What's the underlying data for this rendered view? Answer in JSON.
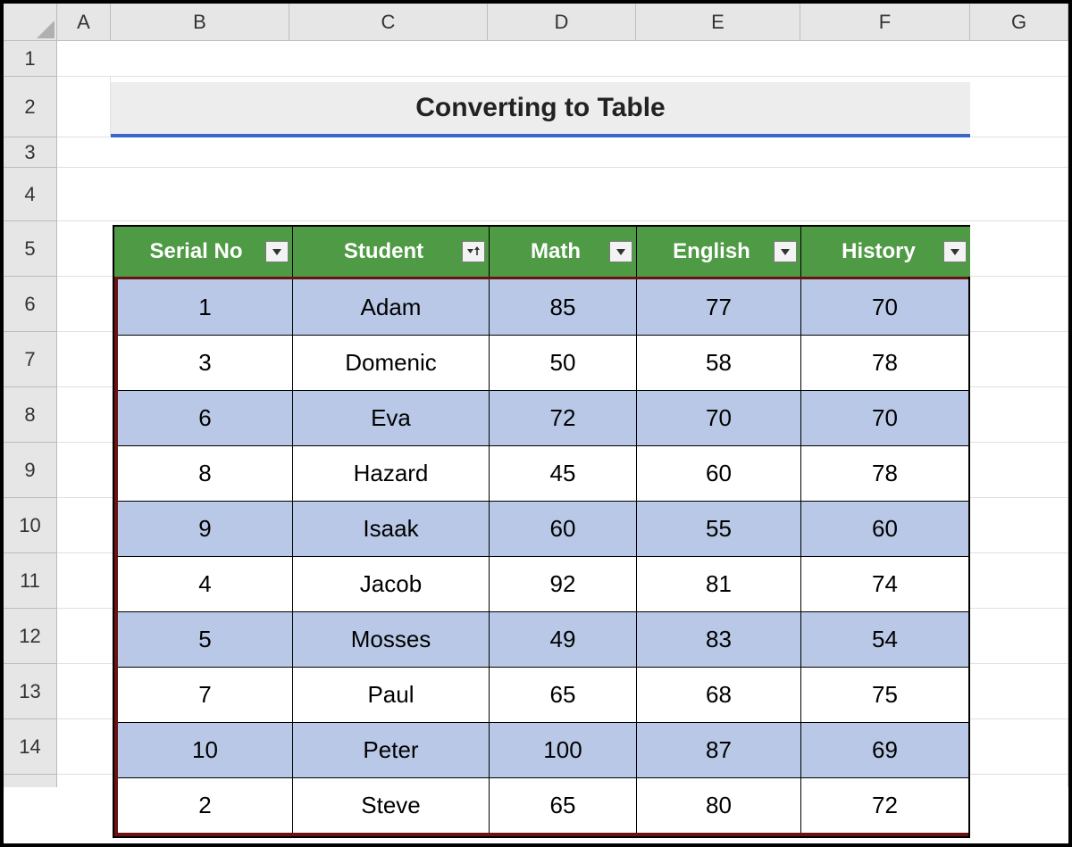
{
  "columns": [
    "A",
    "B",
    "C",
    "D",
    "E",
    "F",
    "G"
  ],
  "rows": [
    "1",
    "2",
    "3",
    "4",
    "5",
    "6",
    "7",
    "8",
    "9",
    "10",
    "11",
    "12",
    "13",
    "14"
  ],
  "title": "Converting to Table",
  "table": {
    "headers": [
      {
        "label": "Serial No",
        "filter": "dropdown"
      },
      {
        "label": "Student",
        "filter": "sort-asc"
      },
      {
        "label": "Math",
        "filter": "dropdown"
      },
      {
        "label": "English",
        "filter": "dropdown"
      },
      {
        "label": "History",
        "filter": "dropdown"
      }
    ],
    "rows": [
      {
        "serial": "1",
        "student": "Adam",
        "math": "85",
        "english": "77",
        "history": "70"
      },
      {
        "serial": "3",
        "student": "Domenic",
        "math": "50",
        "english": "58",
        "history": "78"
      },
      {
        "serial": "6",
        "student": "Eva",
        "math": "72",
        "english": "70",
        "history": "70"
      },
      {
        "serial": "8",
        "student": "Hazard",
        "math": "45",
        "english": "60",
        "history": "78"
      },
      {
        "serial": "9",
        "student": "Isaak",
        "math": "60",
        "english": "55",
        "history": "60"
      },
      {
        "serial": "4",
        "student": "Jacob",
        "math": "92",
        "english": "81",
        "history": "74"
      },
      {
        "serial": "5",
        "student": "Mosses",
        "math": "49",
        "english": "83",
        "history": "54"
      },
      {
        "serial": "7",
        "student": "Paul",
        "math": "65",
        "english": "68",
        "history": "75"
      },
      {
        "serial": "10",
        "student": "Peter",
        "math": "100",
        "english": "87",
        "history": "69"
      },
      {
        "serial": "2",
        "student": "Steve",
        "math": "65",
        "english": "80",
        "history": "72"
      }
    ]
  },
  "chart_data": {
    "type": "table",
    "title": "Converting to Table",
    "columns": [
      "Serial No",
      "Student",
      "Math",
      "English",
      "History"
    ],
    "rows": [
      [
        1,
        "Adam",
        85,
        77,
        70
      ],
      [
        3,
        "Domenic",
        50,
        58,
        78
      ],
      [
        6,
        "Eva",
        72,
        70,
        70
      ],
      [
        8,
        "Hazard",
        45,
        60,
        78
      ],
      [
        9,
        "Isaak",
        60,
        55,
        60
      ],
      [
        4,
        "Jacob",
        92,
        81,
        74
      ],
      [
        5,
        "Mosses",
        49,
        83,
        54
      ],
      [
        7,
        "Paul",
        65,
        68,
        75
      ],
      [
        10,
        "Peter",
        100,
        87,
        69
      ],
      [
        2,
        "Steve",
        65,
        80,
        72
      ]
    ]
  }
}
